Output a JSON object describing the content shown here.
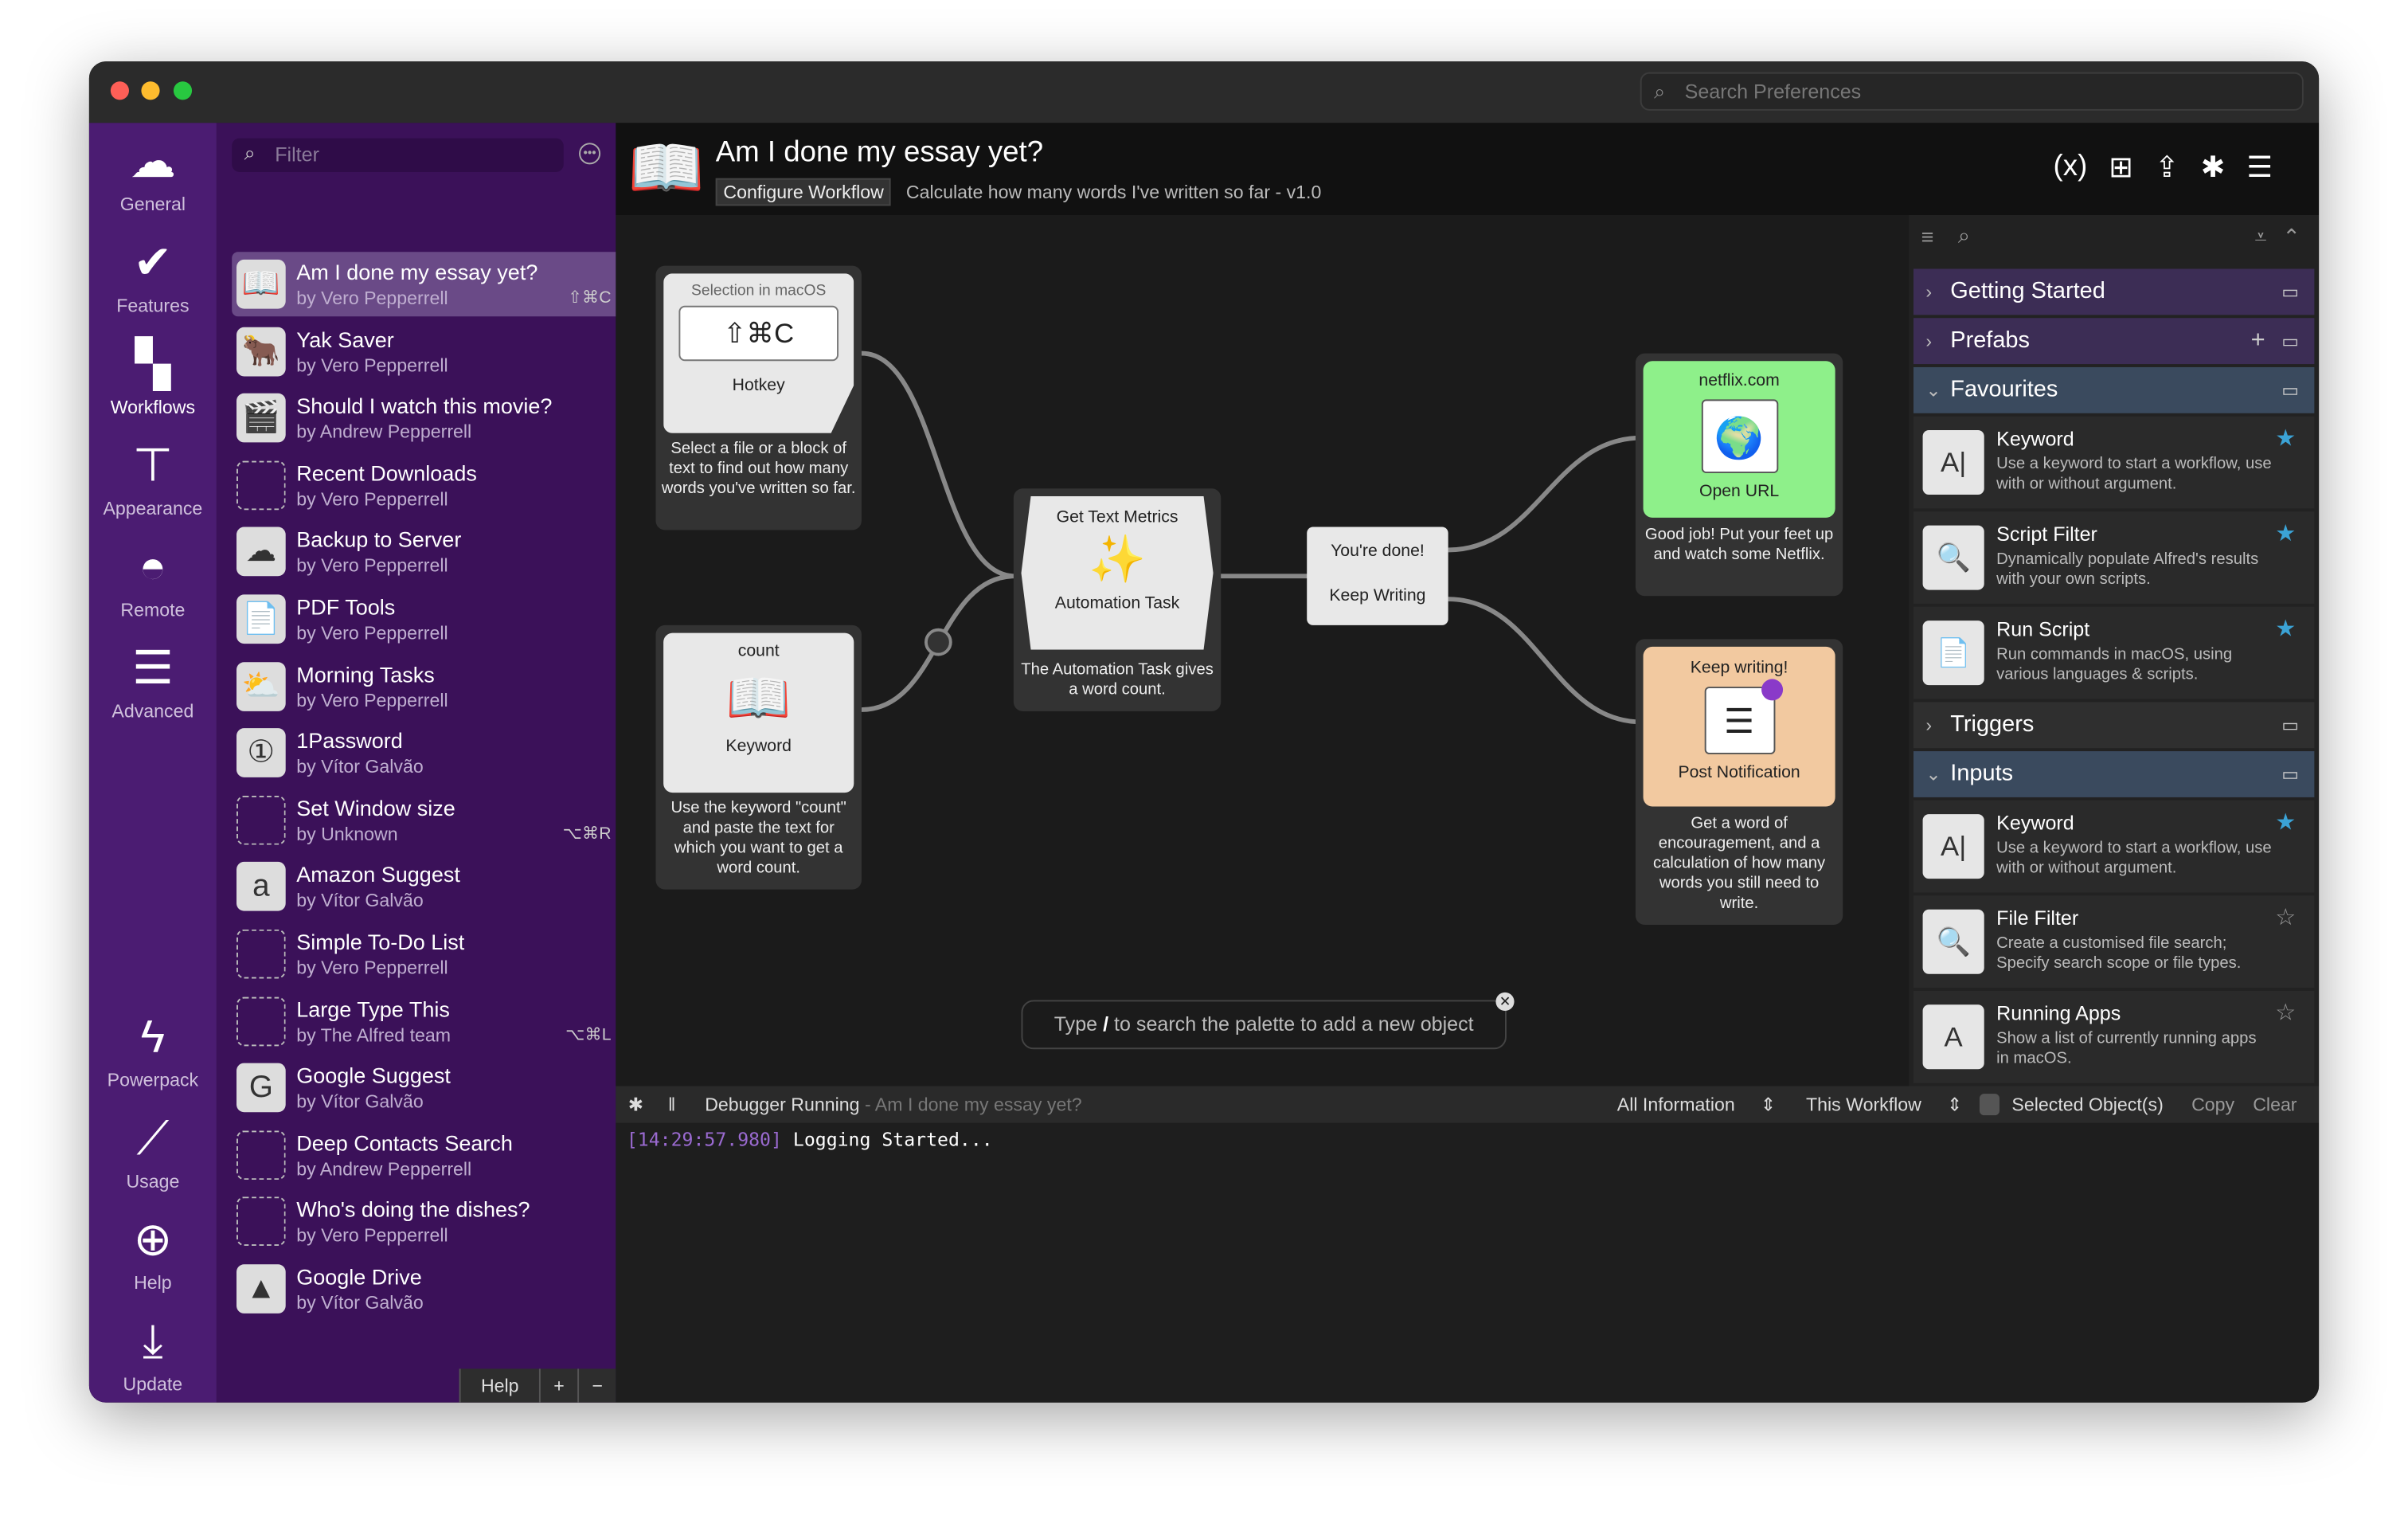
{
  "window": {
    "search_placeholder": "Search Preferences"
  },
  "nav": {
    "top": [
      {
        "label": "General",
        "icon": "cloud-icon"
      },
      {
        "label": "Features",
        "icon": "checkmark-icon"
      },
      {
        "label": "Workflows",
        "icon": "grid-icon",
        "selected": true
      },
      {
        "label": "Appearance",
        "icon": "paint-roller-icon"
      },
      {
        "label": "Remote",
        "icon": "remote-icon"
      },
      {
        "label": "Advanced",
        "icon": "sliders-icon"
      }
    ],
    "bottom": [
      {
        "label": "Powerpack",
        "icon": "battery-bolt-icon"
      },
      {
        "label": "Usage",
        "icon": "chart-icon"
      },
      {
        "label": "Help",
        "icon": "lifebuoy-icon"
      },
      {
        "label": "Update",
        "icon": "download-icon"
      }
    ]
  },
  "workflows": {
    "filter_placeholder": "Filter",
    "items": [
      {
        "title": "Am I done my essay yet?",
        "author": "by Vero Pepperrell",
        "hotkey": "⇧⌘C",
        "selected": true
      },
      {
        "title": "Yak Saver",
        "author": "by Vero Pepperrell",
        "hotkey": ""
      },
      {
        "title": "Should I watch this movie?",
        "author": "by Andrew Pepperrell",
        "hotkey": ""
      },
      {
        "title": "Recent Downloads",
        "author": "by Vero Pepperrell",
        "hotkey": ""
      },
      {
        "title": "Backup to Server",
        "author": "by Vero Pepperrell",
        "hotkey": ""
      },
      {
        "title": "PDF Tools",
        "author": "by Vero Pepperrell",
        "hotkey": ""
      },
      {
        "title": "Morning Tasks",
        "author": "by Vero Pepperrell",
        "hotkey": ""
      },
      {
        "title": "1Password",
        "author": "by Vítor Galvão",
        "hotkey": ""
      },
      {
        "title": "Set Window size",
        "author": "by Unknown",
        "hotkey": "⌥⌘R"
      },
      {
        "title": "Amazon Suggest",
        "author": "by Vítor Galvão",
        "hotkey": ""
      },
      {
        "title": "Simple To-Do List",
        "author": "by Vero Pepperrell",
        "hotkey": ""
      },
      {
        "title": "Large Type This",
        "author": "by The Alfred team",
        "hotkey": "⌥⌘L"
      },
      {
        "title": "Google Suggest",
        "author": "by Vítor Galvão",
        "hotkey": ""
      },
      {
        "title": "Deep Contacts Search",
        "author": "by Andrew Pepperrell",
        "hotkey": ""
      },
      {
        "title": "Who's doing the dishes?",
        "author": "by Vero Pepperrell",
        "hotkey": ""
      },
      {
        "title": "Google Drive",
        "author": "by Vítor Galvão",
        "hotkey": ""
      }
    ],
    "help_label": "Help",
    "add_label": "+",
    "remove_label": "−"
  },
  "header": {
    "title": "Am I done my essay yet?",
    "configure_label": "Configure Workflow",
    "description": "Calculate how many words I've written so far - v1.0"
  },
  "canvas": {
    "hotkey": {
      "top": "Selection in macOS",
      "keys": "⇧⌘C",
      "label": "Hotkey",
      "desc": "Select a file or a block of text to find out how many words you've written so far."
    },
    "keyword": {
      "top": "count",
      "label": "Keyword",
      "desc": "Use the keyword \"count\" and paste the text for which you want to get a word count."
    },
    "automation": {
      "top": "Get Text Metrics",
      "label": "Automation Task",
      "desc": "The Automation Task gives a word count."
    },
    "conditional": {
      "line1": "You're done!",
      "line2": "Keep Writing"
    },
    "openurl": {
      "top": "netflix.com",
      "label": "Open URL",
      "desc": "Good job! Put your feet up and watch some Netflix."
    },
    "notification": {
      "top": "Keep writing!",
      "label": "Post Notification",
      "desc": "Get a word of encouragement, and a calculation of how many words you still need to write."
    },
    "palette_hint_pre": "Type ",
    "palette_hint_key": "/",
    "palette_hint_post": " to search the palette to add a new object"
  },
  "palette": {
    "sections": [
      {
        "label": "Getting Started",
        "expanded": false
      },
      {
        "label": "Prefabs",
        "expanded": false
      },
      {
        "label": "Favourites",
        "expanded": true,
        "items": [
          {
            "title": "Keyword",
            "desc": "Use a keyword to start a workflow, use with or without argument.",
            "starred": true
          },
          {
            "title": "Script Filter",
            "desc": "Dynamically populate Alfred's results with your own scripts.",
            "starred": true
          },
          {
            "title": "Run Script",
            "desc": "Run commands in macOS, using various languages & scripts.",
            "starred": true
          }
        ]
      },
      {
        "label": "Triggers",
        "expanded": false
      },
      {
        "label": "Inputs",
        "expanded": true,
        "items": [
          {
            "title": "Keyword",
            "desc": "Use a keyword to start a workflow, use with or without argument.",
            "starred": true
          },
          {
            "title": "File Filter",
            "desc": "Create a customised file search; Specify search scope or file types.",
            "starred": false
          },
          {
            "title": "Running Apps",
            "desc": "Show a list of currently running apps in macOS.",
            "starred": false
          }
        ]
      }
    ]
  },
  "debugger": {
    "status": "Debugger Running",
    "workflow": " - Am I done my essay yet?",
    "filter1": "All Information",
    "filter2": "This Workflow",
    "selected_label": "Selected Object(s)",
    "copy": "Copy",
    "clear": "Clear",
    "log": [
      {
        "time": "[14:29:57.980]",
        "text": "Logging Started..."
      }
    ]
  },
  "colors": {
    "sidebar": "#4b1c72",
    "list": "#3b1159",
    "accent_star": "#3ba3d6",
    "timestamp": "#9a6ad0",
    "openurl": "#8ef08a",
    "notification": "#f2c9a0"
  }
}
